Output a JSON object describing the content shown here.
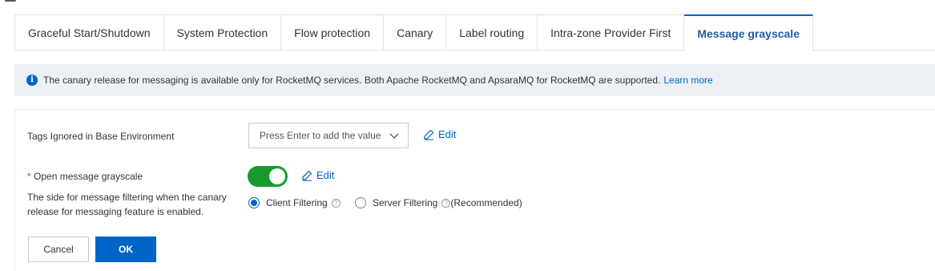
{
  "tabs": [
    {
      "label": "Graceful Start/Shutdown"
    },
    {
      "label": "System Protection"
    },
    {
      "label": "Flow protection"
    },
    {
      "label": "Canary"
    },
    {
      "label": "Label routing"
    },
    {
      "label": "Intra-zone Provider First"
    },
    {
      "label": "Message grayscale",
      "active": true
    }
  ],
  "banner": {
    "text": "The canary release for messaging is available only for RocketMQ services. Both Apache RocketMQ and ApsaraMQ for RocketMQ are supported.",
    "link": "Learn more",
    "icon": "info-icon"
  },
  "form": {
    "tags_label": "Tags Ignored in Base Environment",
    "tags_placeholder": "Press Enter to add the value a",
    "edit_label": "Edit",
    "grayscale_required": "*",
    "grayscale_label": "Open message grayscale",
    "grayscale_enabled": true,
    "filter_label": "The side for message filtering when the canary release for messaging feature is enabled.",
    "filter_options": [
      {
        "label": "Client Filtering",
        "selected": true
      },
      {
        "label": "Server Filtering",
        "suffix": "(Recommended)",
        "selected": false
      }
    ],
    "cancel_label": "Cancel",
    "ok_label": "OK"
  },
  "colors": {
    "accent": "#0064c8",
    "toggle_on": "#189a2f",
    "banner_bg": "#edf1f6"
  }
}
